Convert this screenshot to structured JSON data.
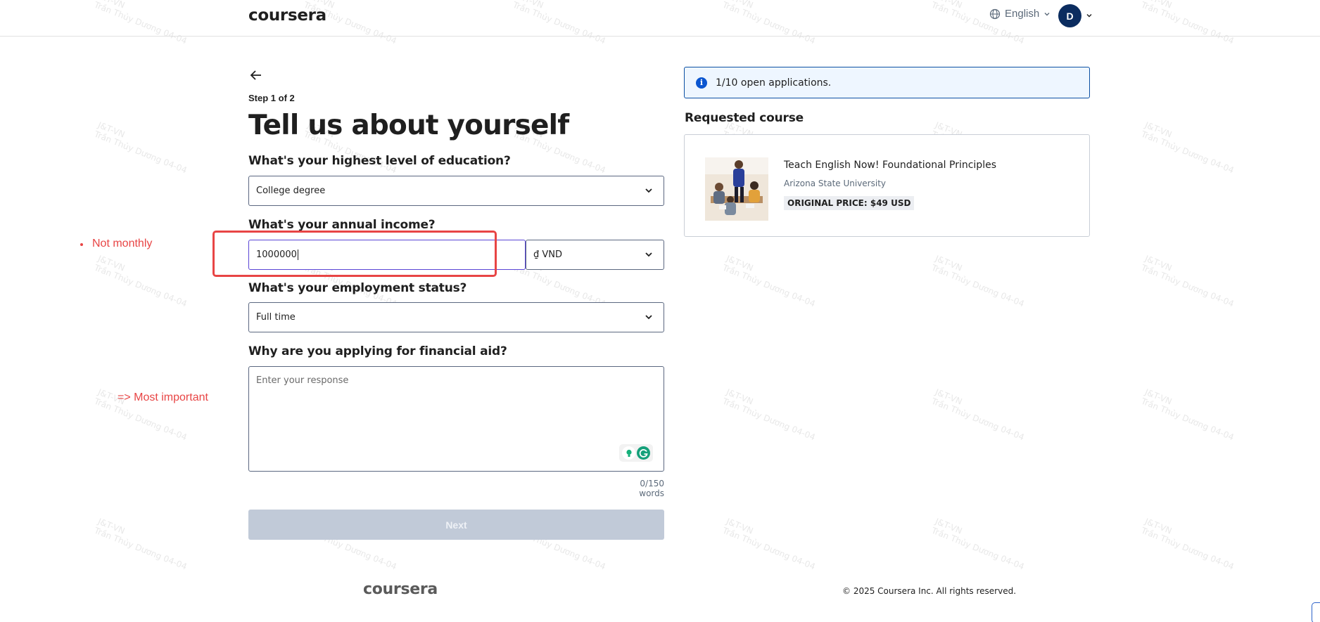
{
  "header": {
    "logo": "coursera",
    "language": "English",
    "avatar_initial": "D"
  },
  "form": {
    "step": "Step 1 of 2",
    "title": "Tell us about yourself",
    "education": {
      "label": "What's your highest level of education?",
      "value": "College degree"
    },
    "income": {
      "label": "What's your annual income?",
      "value": "1000000",
      "currency": "₫ VND"
    },
    "employment": {
      "label": "What's your employment status?",
      "value": "Full time"
    },
    "reason": {
      "label": "Why are you applying for financial aid?",
      "placeholder": "Enter your response",
      "word_count": "0/150 words"
    },
    "next_label": "Next"
  },
  "annotations": {
    "note1": "Not monthly",
    "note2": "=> Most important"
  },
  "sidebar": {
    "info_text": "1/10 open applications.",
    "requested_title": "Requested course",
    "course": {
      "name": "Teach English Now! Foundational Principles",
      "university": "Arizona State University",
      "price": "ORIGINAL PRICE: $49 USD"
    }
  },
  "footer": {
    "logo": "coursera",
    "copyright": "© 2025 Coursera Inc. All rights reserved."
  },
  "watermark": {
    "line1": "J&T-VN",
    "line2": "Trần Thủy Dương 04-04"
  },
  "colors": {
    "accent": "#0b56d0",
    "annotation": "#e84545",
    "focus_border": "#5a45d6",
    "next_disabled": "#c1cad8",
    "avatar_bg": "#0b2c5f"
  }
}
